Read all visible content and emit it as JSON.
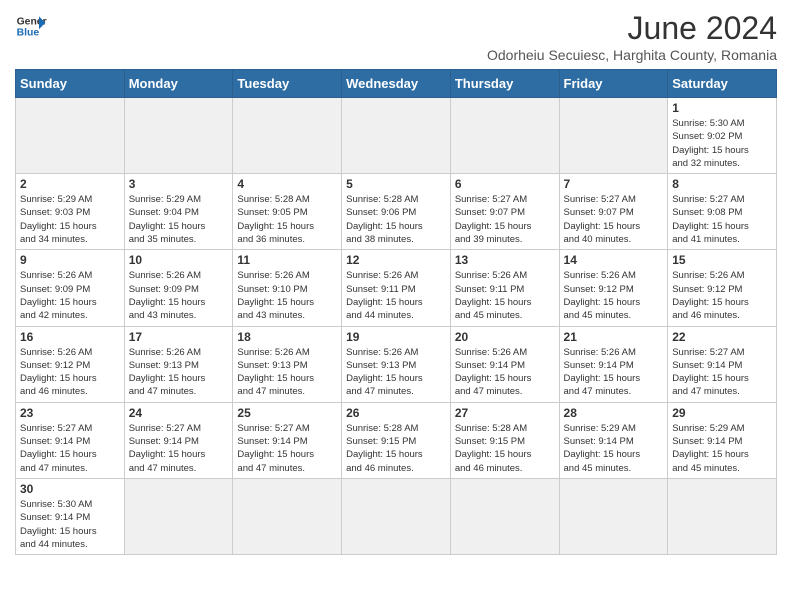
{
  "header": {
    "logo_general": "General",
    "logo_blue": "Blue",
    "month_year": "June 2024",
    "location": "Odorheiu Secuiesc, Harghita County, Romania"
  },
  "weekdays": [
    "Sunday",
    "Monday",
    "Tuesday",
    "Wednesday",
    "Thursday",
    "Friday",
    "Saturday"
  ],
  "weeks": [
    [
      {
        "day": "",
        "info": "",
        "empty": true
      },
      {
        "day": "",
        "info": "",
        "empty": true
      },
      {
        "day": "",
        "info": "",
        "empty": true
      },
      {
        "day": "",
        "info": "",
        "empty": true
      },
      {
        "day": "",
        "info": "",
        "empty": true
      },
      {
        "day": "",
        "info": "",
        "empty": true
      },
      {
        "day": "1",
        "info": "Sunrise: 5:30 AM\nSunset: 9:02 PM\nDaylight: 15 hours\nand 32 minutes."
      }
    ],
    [
      {
        "day": "2",
        "info": "Sunrise: 5:29 AM\nSunset: 9:03 PM\nDaylight: 15 hours\nand 34 minutes."
      },
      {
        "day": "3",
        "info": "Sunrise: 5:29 AM\nSunset: 9:04 PM\nDaylight: 15 hours\nand 35 minutes."
      },
      {
        "day": "4",
        "info": "Sunrise: 5:28 AM\nSunset: 9:05 PM\nDaylight: 15 hours\nand 36 minutes."
      },
      {
        "day": "5",
        "info": "Sunrise: 5:28 AM\nSunset: 9:06 PM\nDaylight: 15 hours\nand 38 minutes."
      },
      {
        "day": "6",
        "info": "Sunrise: 5:27 AM\nSunset: 9:07 PM\nDaylight: 15 hours\nand 39 minutes."
      },
      {
        "day": "7",
        "info": "Sunrise: 5:27 AM\nSunset: 9:07 PM\nDaylight: 15 hours\nand 40 minutes."
      },
      {
        "day": "8",
        "info": "Sunrise: 5:27 AM\nSunset: 9:08 PM\nDaylight: 15 hours\nand 41 minutes."
      }
    ],
    [
      {
        "day": "9",
        "info": "Sunrise: 5:26 AM\nSunset: 9:09 PM\nDaylight: 15 hours\nand 42 minutes."
      },
      {
        "day": "10",
        "info": "Sunrise: 5:26 AM\nSunset: 9:09 PM\nDaylight: 15 hours\nand 43 minutes."
      },
      {
        "day": "11",
        "info": "Sunrise: 5:26 AM\nSunset: 9:10 PM\nDaylight: 15 hours\nand 43 minutes."
      },
      {
        "day": "12",
        "info": "Sunrise: 5:26 AM\nSunset: 9:11 PM\nDaylight: 15 hours\nand 44 minutes."
      },
      {
        "day": "13",
        "info": "Sunrise: 5:26 AM\nSunset: 9:11 PM\nDaylight: 15 hours\nand 45 minutes."
      },
      {
        "day": "14",
        "info": "Sunrise: 5:26 AM\nSunset: 9:12 PM\nDaylight: 15 hours\nand 45 minutes."
      },
      {
        "day": "15",
        "info": "Sunrise: 5:26 AM\nSunset: 9:12 PM\nDaylight: 15 hours\nand 46 minutes."
      }
    ],
    [
      {
        "day": "16",
        "info": "Sunrise: 5:26 AM\nSunset: 9:12 PM\nDaylight: 15 hours\nand 46 minutes."
      },
      {
        "day": "17",
        "info": "Sunrise: 5:26 AM\nSunset: 9:13 PM\nDaylight: 15 hours\nand 47 minutes."
      },
      {
        "day": "18",
        "info": "Sunrise: 5:26 AM\nSunset: 9:13 PM\nDaylight: 15 hours\nand 47 minutes."
      },
      {
        "day": "19",
        "info": "Sunrise: 5:26 AM\nSunset: 9:13 PM\nDaylight: 15 hours\nand 47 minutes."
      },
      {
        "day": "20",
        "info": "Sunrise: 5:26 AM\nSunset: 9:14 PM\nDaylight: 15 hours\nand 47 minutes."
      },
      {
        "day": "21",
        "info": "Sunrise: 5:26 AM\nSunset: 9:14 PM\nDaylight: 15 hours\nand 47 minutes."
      },
      {
        "day": "22",
        "info": "Sunrise: 5:27 AM\nSunset: 9:14 PM\nDaylight: 15 hours\nand 47 minutes."
      }
    ],
    [
      {
        "day": "23",
        "info": "Sunrise: 5:27 AM\nSunset: 9:14 PM\nDaylight: 15 hours\nand 47 minutes."
      },
      {
        "day": "24",
        "info": "Sunrise: 5:27 AM\nSunset: 9:14 PM\nDaylight: 15 hours\nand 47 minutes."
      },
      {
        "day": "25",
        "info": "Sunrise: 5:27 AM\nSunset: 9:14 PM\nDaylight: 15 hours\nand 47 minutes."
      },
      {
        "day": "26",
        "info": "Sunrise: 5:28 AM\nSunset: 9:15 PM\nDaylight: 15 hours\nand 46 minutes."
      },
      {
        "day": "27",
        "info": "Sunrise: 5:28 AM\nSunset: 9:15 PM\nDaylight: 15 hours\nand 46 minutes."
      },
      {
        "day": "28",
        "info": "Sunrise: 5:29 AM\nSunset: 9:14 PM\nDaylight: 15 hours\nand 45 minutes."
      },
      {
        "day": "29",
        "info": "Sunrise: 5:29 AM\nSunset: 9:14 PM\nDaylight: 15 hours\nand 45 minutes."
      }
    ],
    [
      {
        "day": "30",
        "info": "Sunrise: 5:30 AM\nSunset: 9:14 PM\nDaylight: 15 hours\nand 44 minutes."
      },
      {
        "day": "",
        "info": "",
        "empty": true
      },
      {
        "day": "",
        "info": "",
        "empty": true
      },
      {
        "day": "",
        "info": "",
        "empty": true
      },
      {
        "day": "",
        "info": "",
        "empty": true
      },
      {
        "day": "",
        "info": "",
        "empty": true
      },
      {
        "day": "",
        "info": "",
        "empty": true
      }
    ]
  ]
}
